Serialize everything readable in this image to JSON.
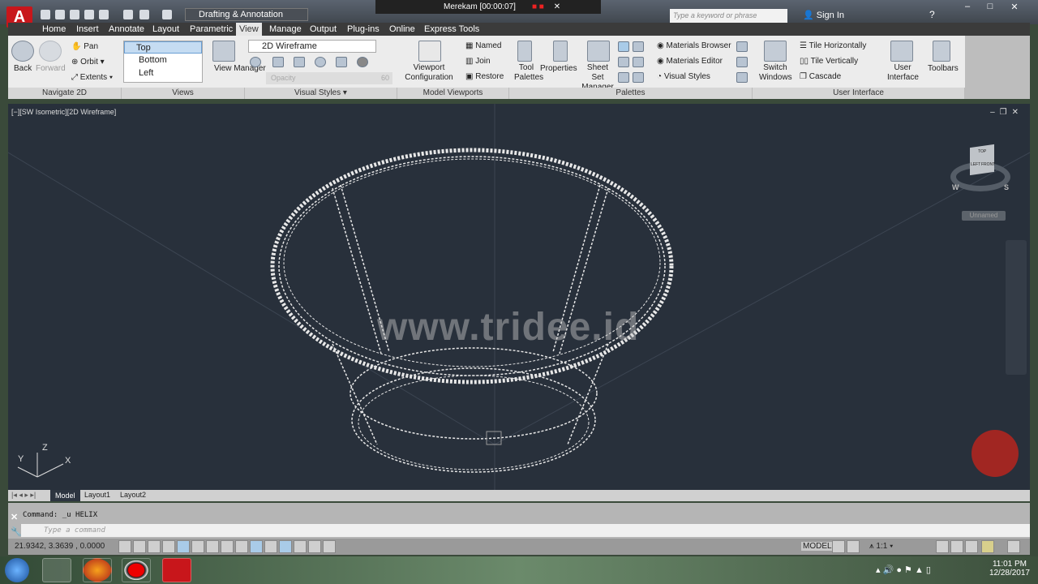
{
  "titlebar": {
    "workspace": "Drafting & Annotation",
    "recorder": "Merekam [00:00:07]",
    "search_placeholder": "Type a keyword or phrase",
    "sign_in": "Sign In"
  },
  "tabs": [
    "Home",
    "Insert",
    "Annotate",
    "Layout",
    "Parametric",
    "View",
    "Manage",
    "Output",
    "Plug-ins",
    "Online",
    "Express Tools"
  ],
  "active_tab": "View",
  "ribbon": {
    "navigate": {
      "title": "Navigate 2D",
      "back": "Back",
      "forward": "Forward",
      "pan": "Pan",
      "orbit": "Orbit",
      "extents": "Extents"
    },
    "views": {
      "title": "Views",
      "items": [
        "Top",
        "Bottom",
        "Left"
      ],
      "manager": "View Manager"
    },
    "visual_styles": {
      "title": "Visual Styles",
      "current": "2D Wireframe",
      "opacity_label": "Opacity",
      "opacity_value": "60"
    },
    "model_viewports": {
      "title": "Model Viewports",
      "config": "Viewport Configuration",
      "named": "Named",
      "join": "Join",
      "restore": "Restore"
    },
    "palettes": {
      "title": "Palettes",
      "tool": "Tool Palettes",
      "properties": "Properties",
      "sheet_set": "Sheet Set Manager",
      "materials_browser": "Materials Browser",
      "materials_editor": "Materials Editor",
      "visual_styles": "Visual Styles"
    },
    "user_interface": {
      "title": "User Interface",
      "switch": "Switch Windows",
      "tile_h": "Tile Horizontally",
      "tile_v": "Tile Vertically",
      "cascade": "Cascade",
      "ui": "User Interface",
      "toolbars": "Toolbars"
    }
  },
  "viewport": {
    "label": "[−][SW Isometric][2D Wireframe]",
    "watermark": "www.tridee.id",
    "viewcube": {
      "top": "TOP",
      "left": "LEFT",
      "front": "FRONT",
      "w": "W",
      "s": "S",
      "ucs": "Unnamed"
    },
    "axes": {
      "x": "X",
      "y": "Y",
      "z": "Z"
    }
  },
  "layout_tabs": [
    "Model",
    "Layout1",
    "Layout2"
  ],
  "command": {
    "history": "Command: _u HELIX",
    "placeholder": "Type a command"
  },
  "status": {
    "coords": "21.9342, 3.3639 , 0.0000",
    "model": "MODEL",
    "scale": "1:1"
  },
  "taskbar": {
    "time": "11:01 PM",
    "date": "12/28/2017"
  }
}
